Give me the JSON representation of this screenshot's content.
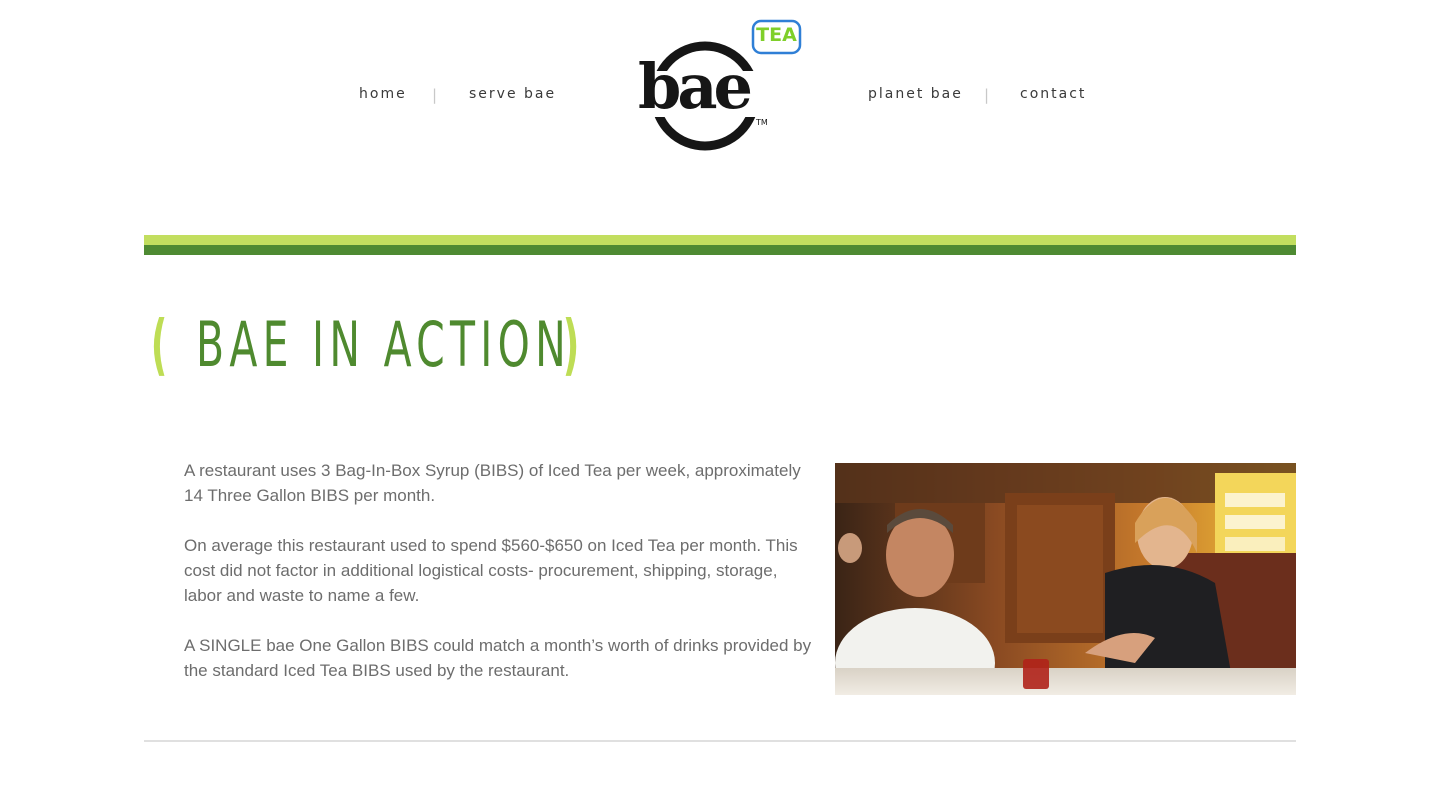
{
  "nav": {
    "left": [
      "home",
      "serve bae"
    ],
    "right": [
      "planet bae",
      "contact"
    ],
    "separator": "|"
  },
  "logo": {
    "wordmark": "bae",
    "badge": "TEA",
    "trademark": "TM",
    "colors": {
      "wordmark": "#1a1a1a",
      "badge_text": "#7fcf2a",
      "badge_border": "#2f7fd6"
    }
  },
  "section": {
    "bracket_open": "(",
    "title": "BAE IN ACTION",
    "bracket_close": ")"
  },
  "content": {
    "paragraphs": [
      "A restaurant uses 3 Bag-In-Box Syrup (BIBS) of Iced Tea per week, approximately 14 Three Gallon BIBS per month.",
      "On average this restaurant used to spend $560-$650 on Iced Tea per month. This cost did not factor in additional logistical costs- procurement, shipping, storage, labor and waste to name a few.",
      "A SINGLE bae One Gallon BIBS could match a month’s worth of drinks provided by the standard Iced Tea BIBS used by the restaurant."
    ]
  },
  "colors": {
    "bar_light": "#c2de5f",
    "bar_dark": "#4e8a32",
    "title": "#4f8a2f",
    "bracket": "#bedd55",
    "body_text": "#6d6d6d"
  }
}
